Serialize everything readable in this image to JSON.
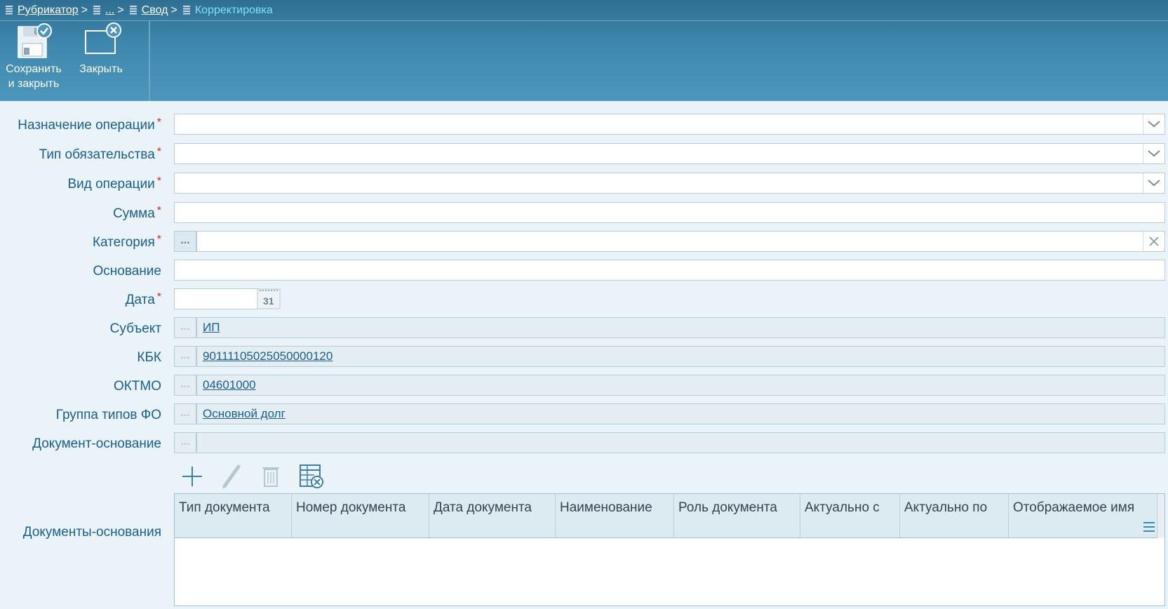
{
  "breadcrumb": {
    "items": [
      "Рубрикатор",
      "...",
      "Свод"
    ],
    "separator": ">",
    "current": "Корректировка"
  },
  "toolbar": {
    "save_line1": "Сохранить",
    "save_line2": "и закрыть",
    "close": "Закрыть"
  },
  "form": {
    "purpose_label": "Назначение операции",
    "obligation_type_label": "Тип обязательства",
    "operation_kind_label": "Вид операции",
    "sum_label": "Сумма",
    "category_label": "Категория",
    "basis_label": "Основание",
    "date_label": "Дата",
    "subject_label": "Субъект",
    "subject_value": "ИП",
    "kbk_label": "КБК",
    "kbk_value": "90111105025050000120",
    "oktmo_label": "ОКТМО",
    "oktmo_value": "04601000",
    "fo_group_label": "Группа типов ФО",
    "fo_group_value": "Основной долг",
    "basis_doc_label": "Документ-основание",
    "dots": "...",
    "required_mark": "*",
    "calendar_day": "31"
  },
  "docs": {
    "label": "Документы-основания",
    "columns": [
      "Тип документа",
      "Номер документа",
      "Дата документа",
      "Наименование",
      "Роль документа",
      "Актуально с",
      "Актуально по",
      "Отображаемое имя"
    ]
  },
  "colors": {
    "header": "#3f88ae",
    "label": "#1a5e8c",
    "required": "#d9262a",
    "current_crumb": "#7fe0ff"
  }
}
